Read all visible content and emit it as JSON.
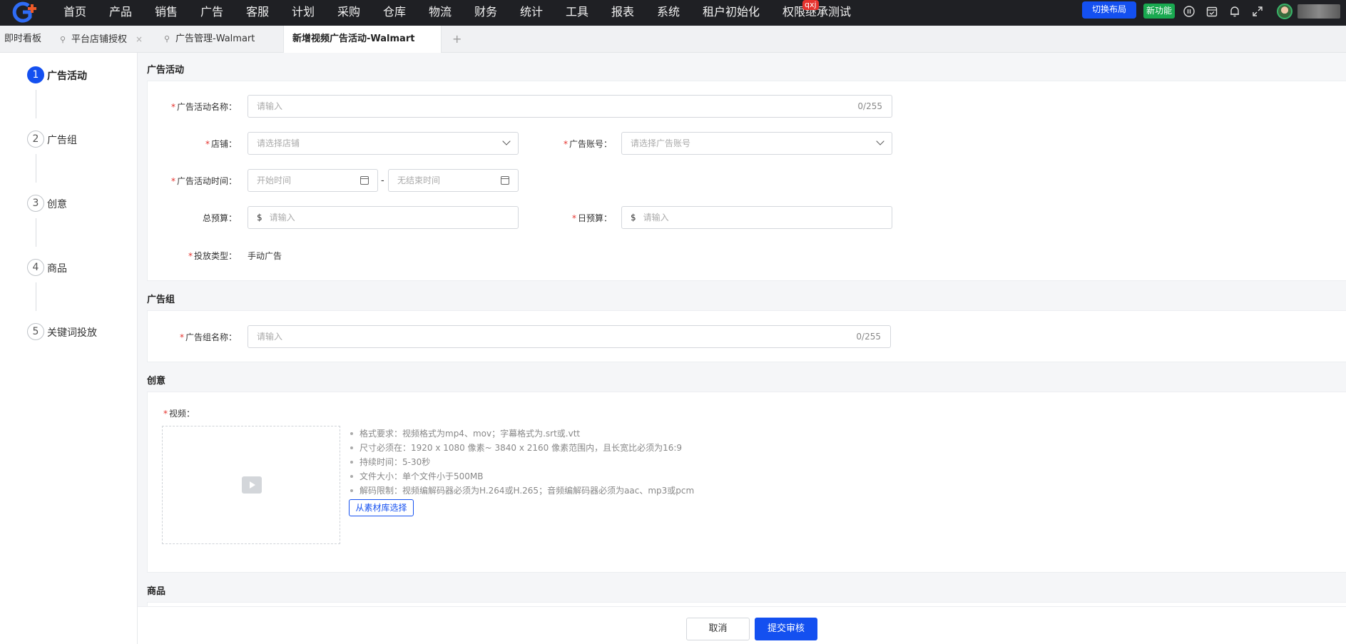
{
  "nav": {
    "items": [
      "首页",
      "产品",
      "销售",
      "广告",
      "客服",
      "计划",
      "采购",
      "仓库",
      "物流",
      "财务",
      "统计",
      "工具",
      "报表",
      "系统",
      "租户初始化",
      "权限继承测试"
    ],
    "badge": "qxj",
    "switch_layout": "切换布局",
    "new_feature": "新功能",
    "icons": [
      "pause-circle-icon",
      "calendar-check-icon",
      "bell-icon",
      "fullscreen-icon"
    ]
  },
  "tabs": [
    {
      "label": "即时看板"
    },
    {
      "label": "平台店铺授权"
    },
    {
      "label": "广告管理-Walmart"
    },
    {
      "label": "新增视频广告活动-Walmart",
      "active": true
    }
  ],
  "tab_add": "+",
  "steps": [
    {
      "num": "1",
      "label": "广告活动",
      "active": true
    },
    {
      "num": "2",
      "label": "广告组"
    },
    {
      "num": "3",
      "label": "创意"
    },
    {
      "num": "4",
      "label": "商品"
    },
    {
      "num": "5",
      "label": "关键词投放"
    }
  ],
  "sections": {
    "campaign": "广告活动",
    "adgroup": "广告组",
    "creative": "创意",
    "product": "商品"
  },
  "form": {
    "campaign_name": {
      "label": "广告活动名称：",
      "placeholder": "请输入",
      "count": "0/255"
    },
    "store": {
      "label": "店铺：",
      "placeholder": "请选择店铺"
    },
    "ad_account": {
      "label": "广告账号：",
      "placeholder": "请选择广告账号"
    },
    "campaign_time": {
      "label": "广告活动时间：",
      "start": "开始时间",
      "end": "无结束时间",
      "sep": "-"
    },
    "total_budget": {
      "label": "总预算：",
      "currency": "$",
      "placeholder": "请输入"
    },
    "daily_budget": {
      "label": "日预算：",
      "currency": "$",
      "placeholder": "请输入"
    },
    "delivery_type": {
      "label": "投放类型：",
      "value": "手动广告"
    },
    "adgroup_name": {
      "label": "广告组名称：",
      "placeholder": "请输入",
      "count": "0/255"
    },
    "video": {
      "label": "视频："
    }
  },
  "video_requirements": [
    "格式要求：视频格式为mp4、mov；字幕格式为.srt或.vtt",
    "尺寸必须在：1920 x 1080 像素~ 3840 x 2160 像素范围内，且长宽比必须为16:9",
    "持续时间：5-30秒",
    "文件大小：单个文件小于500MB",
    "解码限制：视频编解码器必须为H.264或H.265；音频编解码器必须为aac、mp3或pcm"
  ],
  "library_button": "从素材库选择",
  "footer": {
    "cancel": "取消",
    "submit": "提交审核"
  },
  "colors": {
    "primary": "#1450f0",
    "topbar": "#1f2024",
    "required": "#e5322d",
    "new_feature": "#19a950"
  }
}
